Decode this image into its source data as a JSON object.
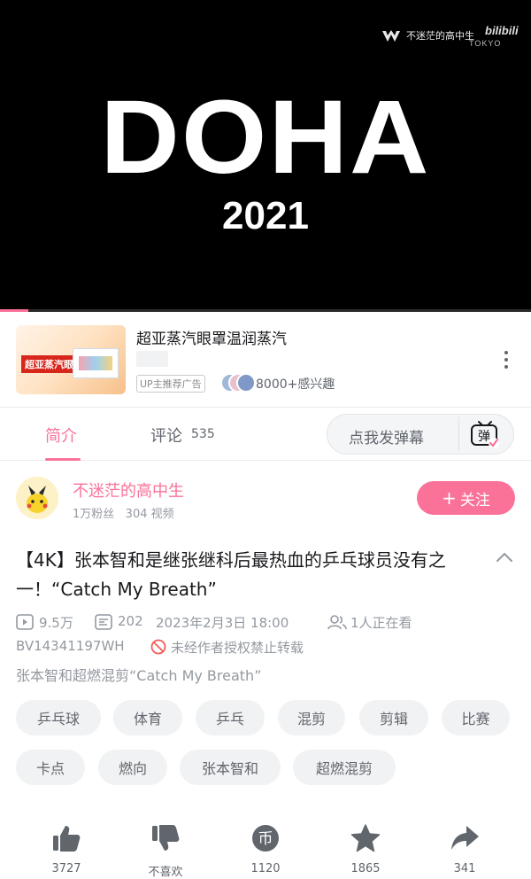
{
  "video": {
    "watermark_text": "不迷茫的高中生",
    "watermark_tokyo": "TOKYO",
    "watermark_brand": "bilibili",
    "title_big": "DOHA",
    "title_year": "2021",
    "progress": 0.053
  },
  "ad": {
    "title": "超亚蒸汽眼罩温润蒸汽",
    "thumb_label": "超亚蒸汽眼罩",
    "tag": "UP主推荐广告",
    "interest": "8000+感兴趣"
  },
  "tabs": {
    "intro": "简介",
    "comments": "评论",
    "comments_count": "535",
    "danmaku_placeholder": "点我发弹幕",
    "danmaku_icon_char": "弹"
  },
  "uploader": {
    "name": "不迷茫的高中生",
    "stats": "1万粉丝   304 视频",
    "follow_plus": "+",
    "follow_label": "关注"
  },
  "video_info": {
    "title": "【4K】张本智和是继张继科后最热血的乒乓球员没有之一！“Catch My Breath”",
    "plays": "9.5万",
    "danmaku_count": "202",
    "date": "2023年2月3日 18:00",
    "watching": "1人正在看",
    "bvid": "BV14341197WH",
    "no_repost": "未经作者授权禁止转载",
    "description": "张本智和超燃混剪“Catch My Breath”"
  },
  "tags": [
    "乒乓球",
    "体育",
    "乒乓",
    "混剪",
    "剪辑",
    "比赛",
    "卡点",
    "燃向",
    "张本智和",
    "超燃混剪"
  ],
  "actions": {
    "like": "3727",
    "dislike": "不喜欢",
    "coin": "1120",
    "coin_char": "币",
    "favorite": "1865",
    "share": "341"
  },
  "colors": {
    "accent": "#fb7299",
    "text": "#18191c",
    "secondary": "#61666d",
    "muted": "#9499a0"
  }
}
